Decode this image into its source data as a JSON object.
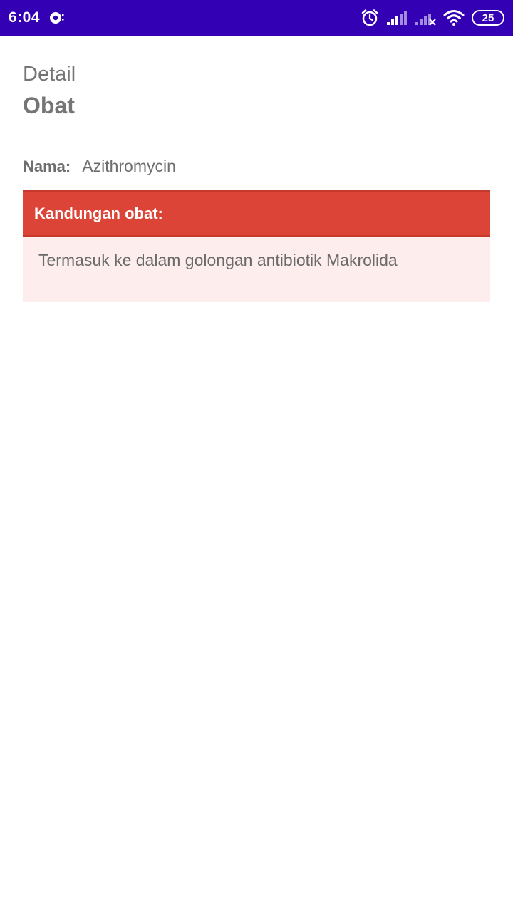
{
  "status_bar": {
    "time": "6:04",
    "battery": "25",
    "background_color": "#3300b3",
    "icons": [
      "sync-icon",
      "alarm-icon",
      "signal-icon",
      "signal-no-sim-icon",
      "wifi-icon",
      "battery-icon"
    ]
  },
  "header": {
    "title_small": "Detail",
    "title_big": "Obat"
  },
  "drug": {
    "name_label": "Nama:",
    "name_value": "Azithromycin"
  },
  "card": {
    "header_label": "Kandungan obat:",
    "body_text": "Termasuk ke dalam golongan antibiotik Makrolida",
    "header_color": "#dc4437",
    "body_color": "#fdeeed"
  }
}
